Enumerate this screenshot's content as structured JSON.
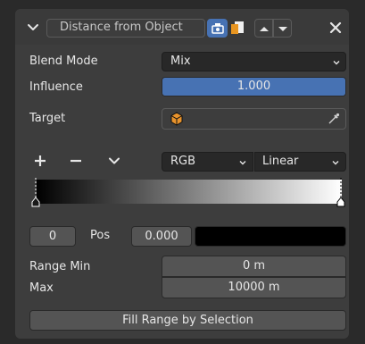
{
  "header": {
    "name_value": "Distance from Object"
  },
  "properties": {
    "blend_mode_label": "Blend Mode",
    "blend_mode_value": "Mix",
    "influence_label": "Influence",
    "influence_value": "1.000",
    "influence_fraction": 1.0,
    "target_label": "Target",
    "target_value": ""
  },
  "color_ramp": {
    "color_mode": "RGB",
    "interpolation": "Linear",
    "active_index": "0",
    "pos_label": "Pos",
    "pos_value": "0.000",
    "stop_colors": [
      "#000000",
      "#ffffff"
    ],
    "stop_positions": [
      0.0,
      1.0
    ],
    "active_color": "#000000"
  },
  "range": {
    "min_label": "Range Min",
    "min_value": "0 m",
    "max_label": "Max",
    "max_value": "10000 m"
  },
  "fill_button_label": "Fill Range by Selection",
  "colors": {
    "accent": "#4772b3",
    "panel": "#3d3d3d",
    "widget": "#545454",
    "field": "#282828",
    "object_icon": "#e8932c"
  },
  "icons": [
    "collapse-arrow-icon",
    "camera-restrict-icon",
    "copy-icon",
    "move-up-icon",
    "move-down-icon",
    "close-icon",
    "object-cube-icon",
    "eyedropper-icon",
    "add-stop-icon",
    "remove-stop-icon",
    "ramp-menu-icon"
  ]
}
